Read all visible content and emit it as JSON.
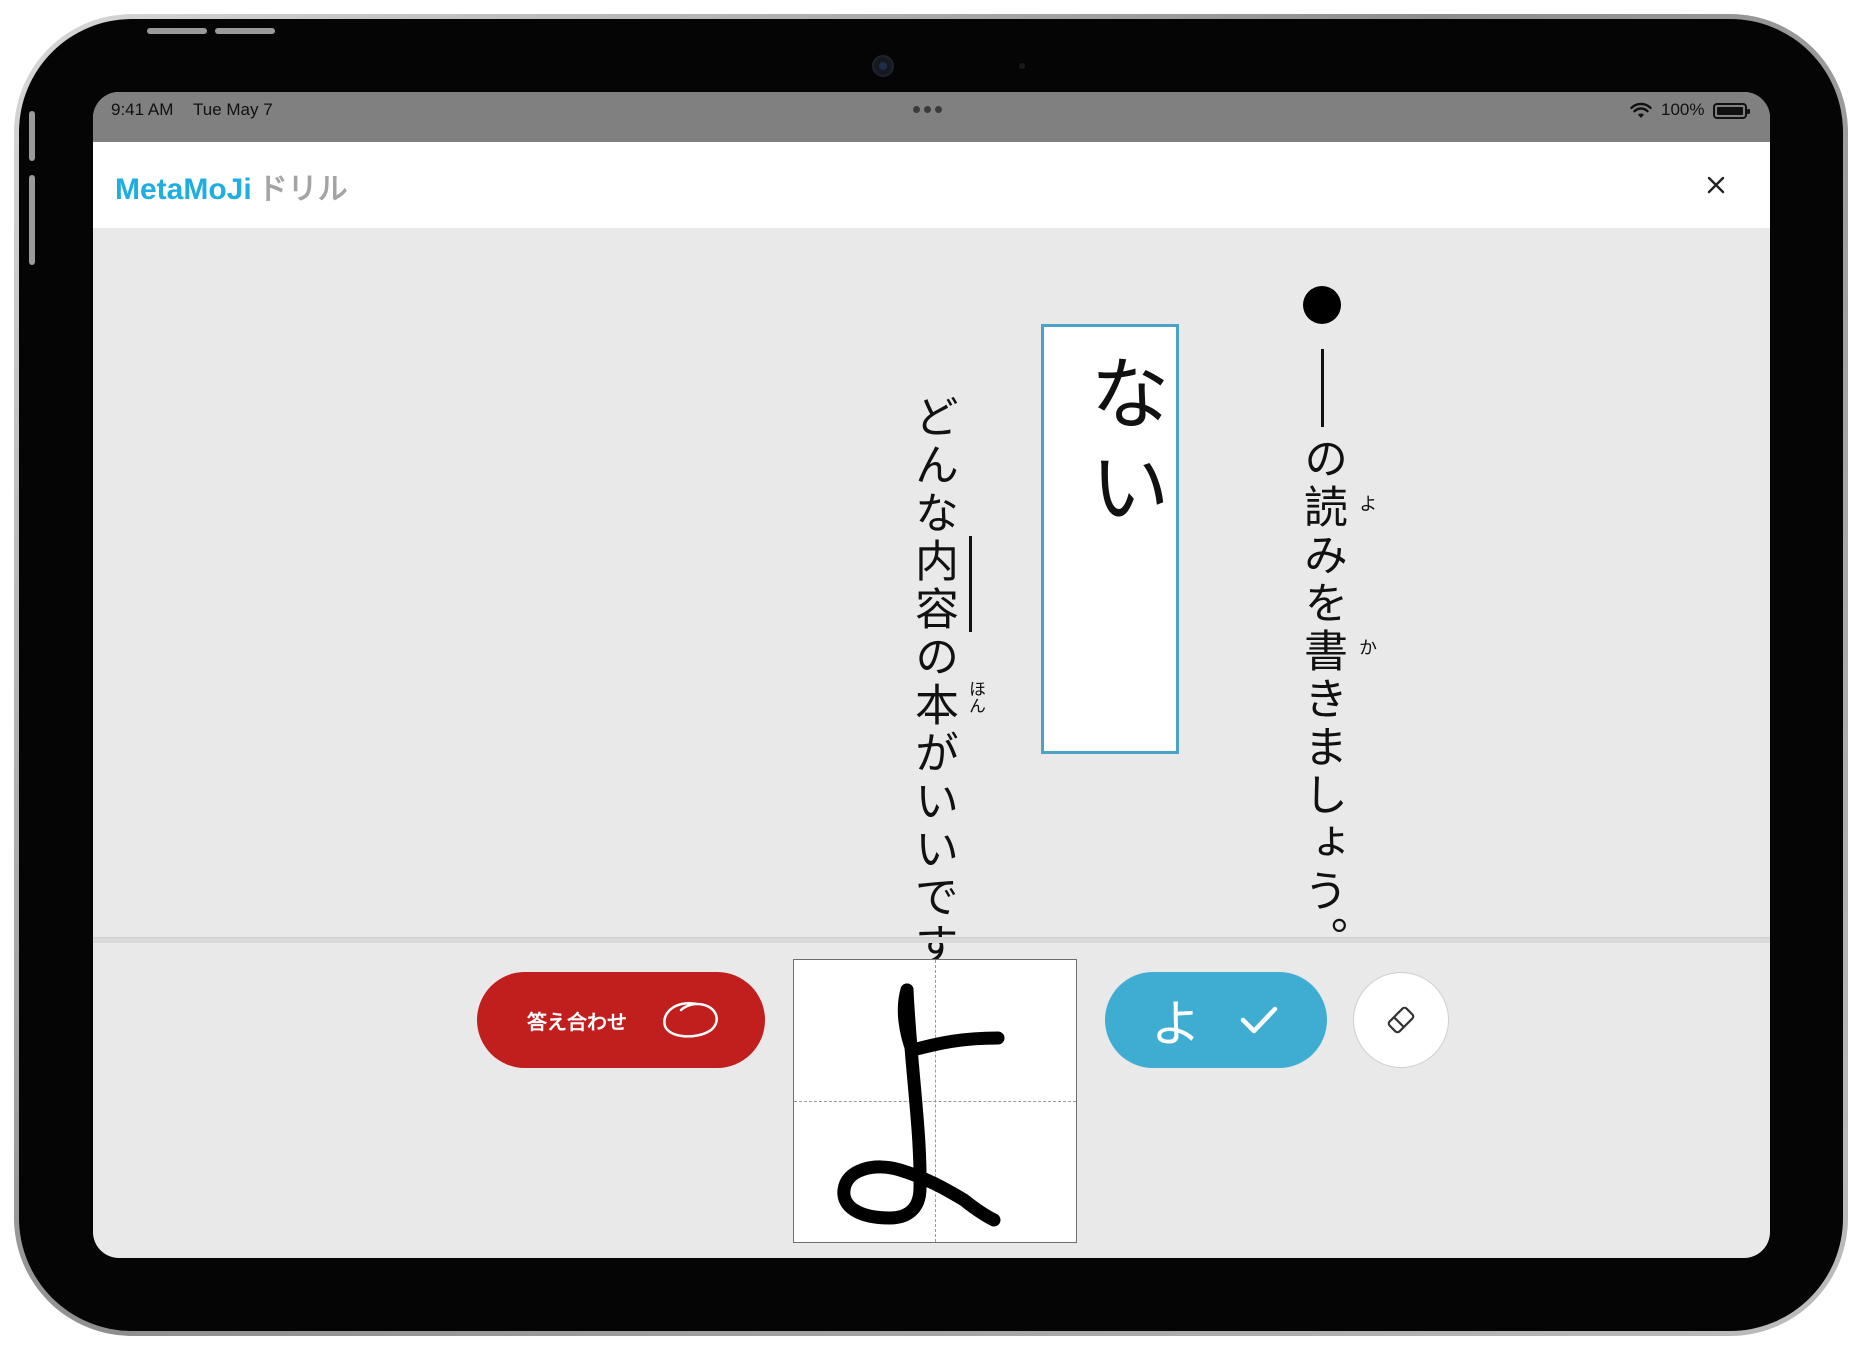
{
  "status_bar": {
    "time": "9:41 AM",
    "date": "Tue May 7",
    "battery": "100%"
  },
  "header": {
    "brand_main": "MetaMoJi",
    "brand_sub": "ドリル",
    "close_icon": "close-icon"
  },
  "question": {
    "instruction": "の読みを書きましょう。",
    "instruction_ruby": [
      "よ",
      "か"
    ],
    "answer_box_text": "ない",
    "sentence": "どんな内容の本がいいです",
    "sentence_ruby": "ほん"
  },
  "controls": {
    "check_answer_label": "答え合わせ",
    "recognized_char": "よ",
    "icons": [
      "circle-mark-icon",
      "checkmark-icon",
      "eraser-icon"
    ]
  },
  "colors": {
    "brand": "#1eaee0",
    "check_answer": "#c11e1e",
    "recognized": "#3eadd1",
    "answer_box_border": "#4aa3c7"
  }
}
